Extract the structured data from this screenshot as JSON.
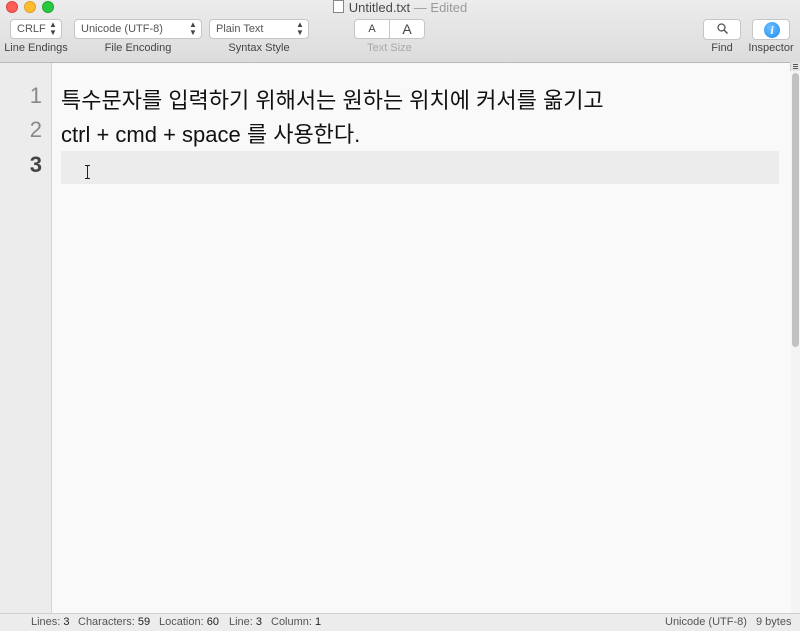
{
  "window": {
    "filename": "Untitled.txt",
    "edited_suffix": "— Edited"
  },
  "toolbar": {
    "line_endings": {
      "value": "CRLF",
      "label": "Line Endings"
    },
    "file_encoding": {
      "value": "Unicode (UTF-8)",
      "label": "File Encoding"
    },
    "syntax_style": {
      "value": "Plain Text",
      "label": "Syntax Style"
    },
    "text_size": {
      "small_glyph": "A",
      "large_glyph": "A",
      "label": "Text Size"
    },
    "find": {
      "label": "Find",
      "icon": "magnifier-icon"
    },
    "inspector": {
      "label": "Inspector",
      "icon": "info-icon",
      "glyph": "i"
    }
  },
  "editor": {
    "lines": [
      {
        "number": "1",
        "text": "특수문자를 입력하기 위해서는 원하는 위치에 커서를 옮기고"
      },
      {
        "number": "2",
        "text": "ctrl + cmd + space 를 사용한다."
      },
      {
        "number": "3",
        "text": ""
      }
    ],
    "current_line": 3
  },
  "status": {
    "lines_label": "Lines:",
    "lines": "3",
    "characters_label": "Characters:",
    "characters": "59",
    "location_label": "Location:",
    "location": "60",
    "line_label": "Line:",
    "line": "3",
    "column_label": "Column:",
    "column": "1",
    "encoding": "Unicode (UTF-8)",
    "size": "9 bytes"
  },
  "colors": {
    "close": "#fc5f57",
    "minimize": "#fdbc2e",
    "maximize": "#28c840",
    "inspector_accent": "#1a8cf0",
    "current_line_bg": "#ececec"
  }
}
